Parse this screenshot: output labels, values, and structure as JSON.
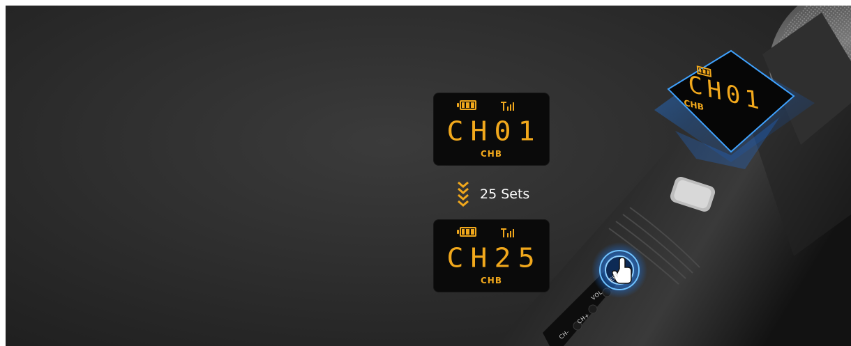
{
  "panels": [
    {
      "channel": "CH01",
      "sub": "CHB"
    },
    {
      "channel": "CH25",
      "sub": "CHB"
    }
  ],
  "sets_label": "25 Sets",
  "mic_display": {
    "channel": "CH01",
    "sub": "CHB"
  },
  "mic_buttons": {
    "eff": "EFF",
    "vol": "VOL",
    "ch_plus": "CH+",
    "ch_minus": "CH-"
  },
  "colors": {
    "lcd_amber": "#f1a81c",
    "accent_blue": "#2a8cff",
    "background": "#2a2a2a"
  }
}
